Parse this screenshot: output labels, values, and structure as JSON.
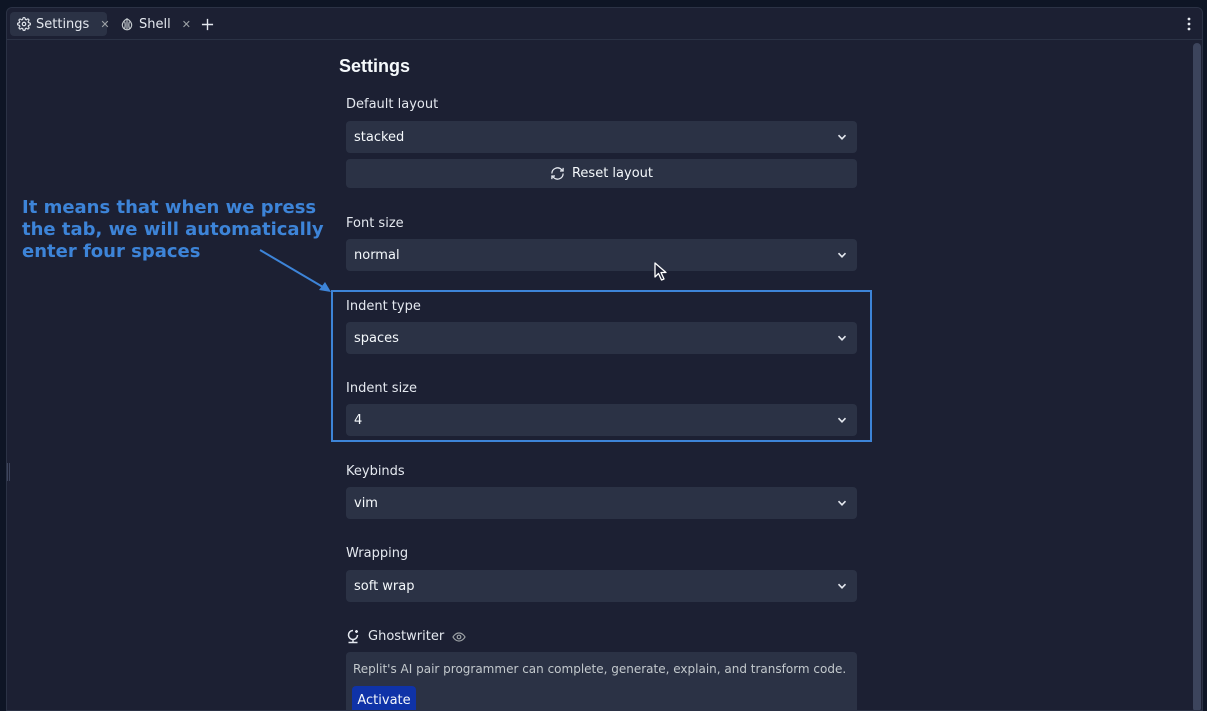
{
  "tabs": [
    {
      "label": "Settings",
      "icon": "gear-icon",
      "active": true
    },
    {
      "label": "Shell",
      "icon": "shell-icon",
      "active": false
    }
  ],
  "page_title": "Settings",
  "settings": {
    "default_layout": {
      "label": "Default layout",
      "value": "stacked"
    },
    "reset_layout_label": "Reset layout",
    "font_size": {
      "label": "Font size",
      "value": "normal"
    },
    "indent_type": {
      "label": "Indent type",
      "value": "spaces"
    },
    "indent_size": {
      "label": "Indent size",
      "value": "4"
    },
    "keybinds": {
      "label": "Keybinds",
      "value": "vim"
    },
    "wrapping": {
      "label": "Wrapping",
      "value": "soft wrap"
    }
  },
  "ghostwriter": {
    "label": "Ghostwriter",
    "description": "Replit's AI pair programmer can complete, generate, explain, and transform code.",
    "activate_label": "Activate"
  },
  "annotation": {
    "line1": "It means that when we press",
    "line2": "the tab, we will automatically",
    "line3": "enter four spaces"
  },
  "colors": {
    "annotation": "#3d84d8",
    "activate_button": "#0f33a8",
    "panel": "#1c2033",
    "control": "#2b3245"
  }
}
